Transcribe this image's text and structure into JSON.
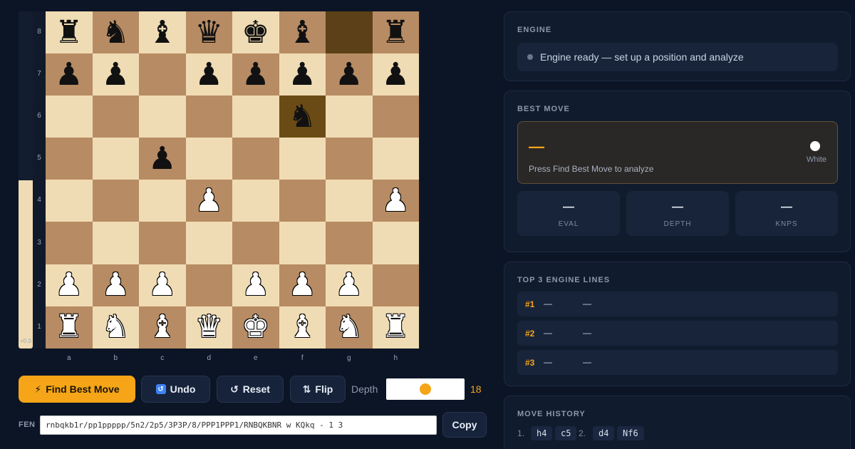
{
  "eval_bar": {
    "white_share": 0.5,
    "label": "+0.0"
  },
  "board": {
    "rank_labels": [
      "8",
      "7",
      "6",
      "5",
      "4",
      "3",
      "2",
      "1"
    ],
    "file_labels": [
      "a",
      "b",
      "c",
      "d",
      "e",
      "f",
      "g",
      "h"
    ],
    "highlight": {
      "from": "g8",
      "to": "f6"
    },
    "ranks": [
      [
        "br",
        "bn",
        "bb",
        "bq",
        "bk",
        "bb",
        "",
        "br"
      ],
      [
        "bp",
        "bp",
        "",
        "bp",
        "bp",
        "bp",
        "bp",
        "bp"
      ],
      [
        "",
        "",
        "",
        "",
        "",
        "bn",
        "",
        ""
      ],
      [
        "",
        "",
        "bp",
        "",
        "",
        "",
        "",
        ""
      ],
      [
        "",
        "",
        "",
        "wp",
        "",
        "",
        "",
        "wp"
      ],
      [
        "",
        "",
        "",
        "",
        "",
        "",
        "",
        ""
      ],
      [
        "wp",
        "wp",
        "wp",
        "",
        "wp",
        "wp",
        "wp",
        ""
      ],
      [
        "wr",
        "wn",
        "wb",
        "wq",
        "wk",
        "wb",
        "wn",
        "wr"
      ]
    ]
  },
  "controls": {
    "find_best_move": "Find Best Move",
    "undo": "Undo",
    "reset": "Reset",
    "flip": "Flip",
    "depth_label": "Depth",
    "depth_value": "18",
    "depth_fraction": 0.5
  },
  "fen": {
    "label": "FEN",
    "value": "rnbqkb1r/pp1ppppp/5n2/2p5/3P3P/8/PPP1PPP1/RNBQKBNR w KQkq - 1 3",
    "copy": "Copy"
  },
  "engine_panel": {
    "title": "ENGINE",
    "status": "Engine ready — set up a position and analyze"
  },
  "best_move_panel": {
    "title": "BEST MOVE",
    "move": "—",
    "hint": "Press Find Best Move to analyze",
    "side": "White",
    "stats": [
      {
        "value": "—",
        "label": "EVAL"
      },
      {
        "value": "—",
        "label": "DEPTH"
      },
      {
        "value": "—",
        "label": "KNPS"
      }
    ]
  },
  "lines_panel": {
    "title": "TOP 3 ENGINE LINES",
    "lines": [
      {
        "rank": "#1",
        "score": "—",
        "pv": "—"
      },
      {
        "rank": "#2",
        "score": "—",
        "pv": "—"
      },
      {
        "rank": "#3",
        "score": "—",
        "pv": "—"
      }
    ]
  },
  "history_panel": {
    "title": "MOVE HISTORY",
    "moves": [
      {
        "num": "1.",
        "white": "h4",
        "black": "c5"
      },
      {
        "num": "2.",
        "white": "d4",
        "black": "Nf6"
      }
    ]
  },
  "colors": {
    "accent": "#f5a517",
    "light_square": "#f0dcb4",
    "dark_square": "#b78b63",
    "background": "#0b1526"
  },
  "icons": {
    "find": "lightning-icon",
    "undo": "undo-icon",
    "reset": "reset-icon",
    "flip": "flip-icon"
  }
}
